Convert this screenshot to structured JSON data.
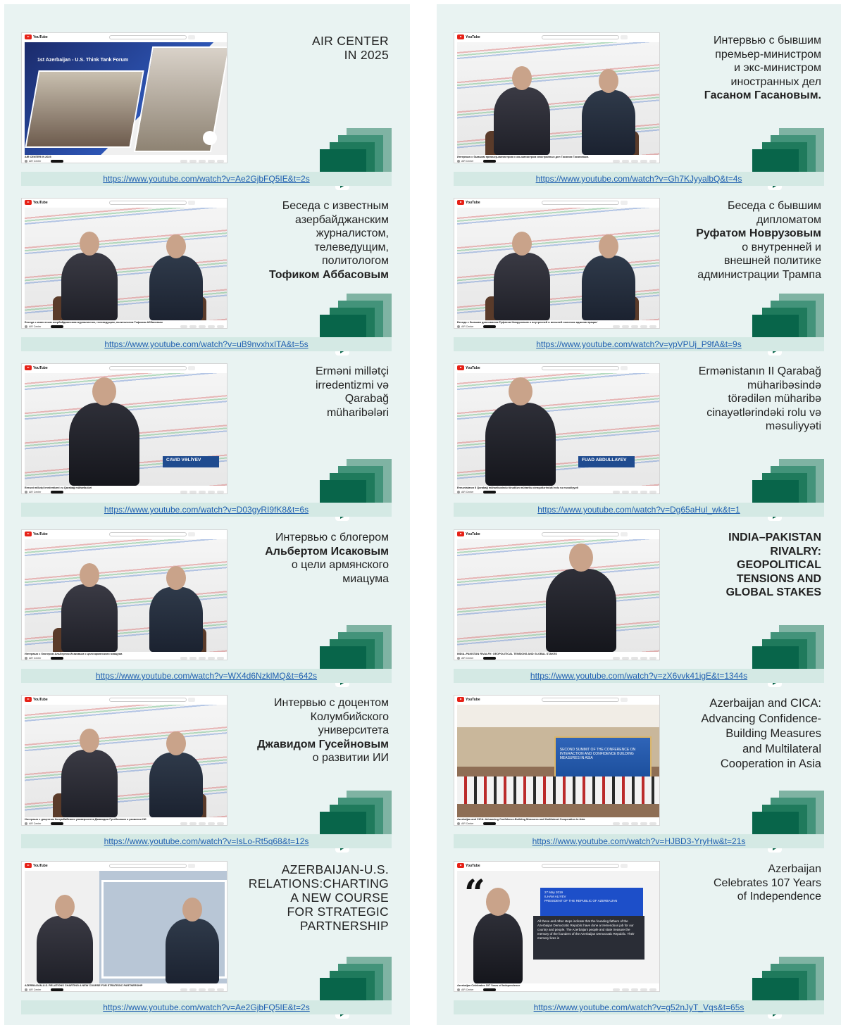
{
  "cards": [
    {
      "title": "AIR CENTER\nIN 2025",
      "url": "https://www.youtube.com/watch?v=Ae2GjbFQ5IE&t=2s ",
      "caption": "AIR CENTER IN 2025",
      "forum_text": "1st Azerbaijan - U.S. Think Tank Forum"
    },
    {
      "title_lines": "Интервью с бывшим\nпремьер-министром\nи экс-министром\nиностранных дел",
      "title_bold": "Гасаном Гасановым.",
      "url": "https://www.youtube.com/watch?v=Gh7KJyyalbQ&t=4s",
      "caption": "Интервью с бывшим премьер-министром и экс-министром иностранных дел Гасаном Гасановым."
    },
    {
      "title_lines": "Беседа с известным\nазербайджанским\nжурналистом,\nтелеведущим,\nполитологом",
      "title_bold": "Тофиком Аббасовым",
      "url": "https://www.youtube.com/watch?v=uB9nvxhxITA&t=5s",
      "caption": "Беседа с известным азербайджанским журналистом, телеведущим, политологом Тофиком Аббасовым"
    },
    {
      "title_lines": "Беседа с бывшим\nдипломатом",
      "title_bold": "Руфатом Новрузовым",
      "title_after": "о внутренней и\nвнешней политике\nадминистрации Трампа",
      "url": "https://www.youtube.com/watch?v=ypVPUj_P9fA&t=9s",
      "caption": "Беседа с бывшим дипломатом Руфатом Новрузовым о внутренней и внешней политике администрации Трампа"
    },
    {
      "title": "Erməni millətçi\nirredentizmi və\nQarabağ\nmüharibələri",
      "url": "https://www.youtube.com/watch?v=D03gyRI9fK8&t=6s ",
      "caption": "Erməni millətçi irredentizmi və Qarabağ müharibələri",
      "name_tag": "CAVID VƏLİYEV"
    },
    {
      "title": "Ermənistanın II Qarabağ\nmüharibəsində\ntörədilən müharibə\ncinayətlərindəki rolu və\nməsuliyyəti",
      "url": "https://www.youtube.com/watch?v=Dg65aHul_wk&t=1",
      "caption": "Ermənistanın II Qarabağ müharibəsində törədilən müharibə cinayətlərindəki rolu və məsuliyyəti",
      "name_tag": "FUAD ABDULLAYEV"
    },
    {
      "title_lines": "Интервью с блогером",
      "title_bold": "Альбертом Исаковым",
      "title_after": "о цели армянского\nмиацума",
      "url": "https://www.youtube.com/watch?v=WX4d6NzklMQ&t=642s",
      "caption": "Интервью с блогером Альбертом Исаковым о цели армянского миацума"
    },
    {
      "title": "INDIA–PAKISTAN\nRIVALRY:\nGEOPOLITICAL\nTENSIONS AND\nGLOBAL STAKES",
      "url": "https://www.youtube.com/watch?v=zX6vvk41igE&t=1344s ",
      "caption": "INDIA–PAKISTAN RIVALRY: GEOPOLITICAL TENSIONS AND GLOBAL STAKES"
    },
    {
      "title_lines": "Интервью с доцентом\nКолумбийского\nуниверситета",
      "title_bold": "Джавидом Гусейновым",
      "title_after": "о развитии ИИ",
      "url": "https://www.youtube.com/watch?v=IsLo-Rt5q68&t=12s ",
      "caption": "Интервью с доцентом Колумбийского университета Джавидом Гусейновым о развитии ИИ"
    },
    {
      "title": "Azerbaijan and CICA:\nAdvancing Confidence-\nBuilding Measures\nand Multilateral\nCooperation in Asia",
      "url": "https://www.youtube.com/watch?v=HJBD3-YryHw&t=21s",
      "caption": "Azerbaijan and CICA: Advancing Confidence-Building Measures and Multilateral Cooperation in Asia",
      "banner_text": "SECOND SUMMIT OF THE CONFERENCE ON INTERACTION AND CONFIDENCE BUILDING MEASURES IN ASIA"
    },
    {
      "title": "AZERBAIJAN-U.S.\nRELATIONS:CHARTING\nA NEW COURSE\nFOR STRATEGIC\nPARTNERSHIP",
      "url": "https://www.youtube.com/watch?v=Ae2GjbFQ5IE&t=2s ",
      "caption": "AZERBAIJAN-U.S. RELATIONS CHARTING A NEW COURSE FOR STRATEGIC PARTNERSHIP"
    },
    {
      "title": "Azerbaijan\nCelebrates 107 Years\nof Independence",
      "url": "https://www.youtube.com/watch?v=g52nJyT_Vqs&t=65s",
      "caption": "Azerbaijan Celebrates 107 Years of Independence",
      "quote_date": "27 May 2019",
      "quote_name": "ILHAM ALIYEV",
      "quote_role": "PRESIDENT OF THE REPUBLIC OF AZERBAIJAN",
      "quote_body": "All these and other steps indicate that the founding fathers of the Azerbaijan Democratic Republic have done a tremendous job for our country and people. The Azerbaijani people and state treasure the memory of the founders of the Azerbaijan Democratic Republic. Their memory lives in"
    }
  ],
  "colors": {
    "panel": "#e9f3f2",
    "link_bar": "#d4e9e4",
    "link": "#1f5fb0",
    "green_dark": "#08654a",
    "green_light": "#7fb3a3"
  }
}
